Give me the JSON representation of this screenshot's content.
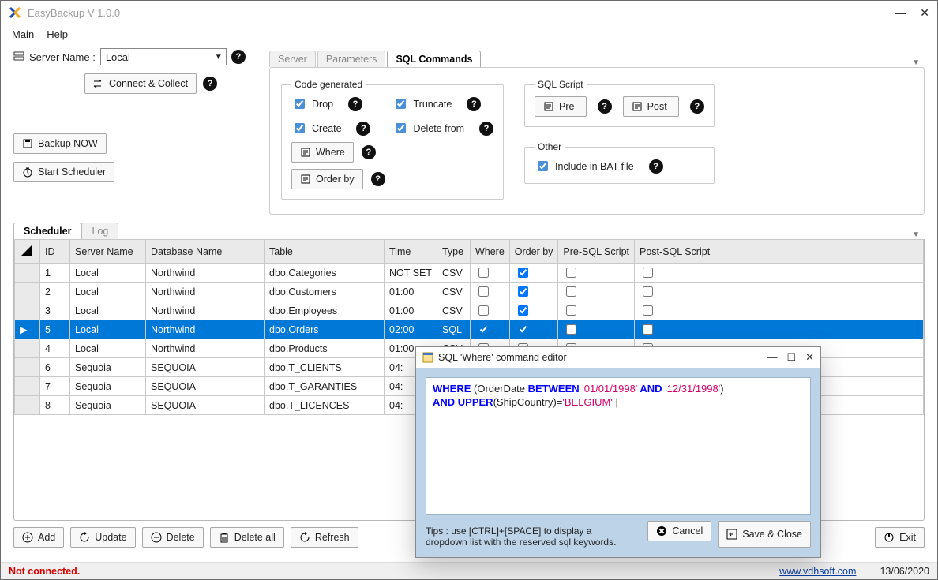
{
  "window": {
    "title": "EasyBackup V 1.0.0"
  },
  "menu": {
    "main": "Main",
    "help": "Help"
  },
  "server": {
    "label": "Server Name :",
    "value": "Local",
    "connect": "Connect & Collect"
  },
  "actions": {
    "backup": "Backup NOW",
    "scheduler": "Start Scheduler"
  },
  "tabs": {
    "server": "Server",
    "parameters": "Parameters",
    "sqlcmds": "SQL Commands"
  },
  "codegen": {
    "legend": "Code generated",
    "drop": "Drop",
    "create": "Create",
    "truncate": "Truncate",
    "deletefrom": "Delete from",
    "where": "Where",
    "orderby": "Order by"
  },
  "sqlscript": {
    "legend": "SQL Script",
    "pre": "Pre-",
    "post": "Post-"
  },
  "other": {
    "legend": "Other",
    "bat": "Include in BAT file"
  },
  "gridtabs": {
    "scheduler": "Scheduler",
    "log": "Log"
  },
  "columns": {
    "id": "ID",
    "server": "Server Name",
    "db": "Database Name",
    "table": "Table",
    "time": "Time",
    "type": "Type",
    "where": "Where",
    "orderby": "Order by",
    "pre": "Pre-SQL Script",
    "post": "Post-SQL Script"
  },
  "rows": [
    {
      "id": "1",
      "server": "Local",
      "db": "Northwind",
      "table": "dbo.Categories",
      "time": "NOT SET",
      "type": "CSV",
      "where": false,
      "orderby": true,
      "pre": false,
      "post": false,
      "selected": false
    },
    {
      "id": "2",
      "server": "Local",
      "db": "Northwind",
      "table": "dbo.Customers",
      "time": "01:00",
      "type": "CSV",
      "where": false,
      "orderby": true,
      "pre": false,
      "post": false,
      "selected": false
    },
    {
      "id": "3",
      "server": "Local",
      "db": "Northwind",
      "table": "dbo.Employees",
      "time": "01:00",
      "type": "CSV",
      "where": false,
      "orderby": true,
      "pre": false,
      "post": false,
      "selected": false
    },
    {
      "id": "5",
      "server": "Local",
      "db": "Northwind",
      "table": "dbo.Orders",
      "time": "02:00",
      "type": "SQL",
      "where": true,
      "orderby": true,
      "pre": false,
      "post": false,
      "selected": true
    },
    {
      "id": "4",
      "server": "Local",
      "db": "Northwind",
      "table": "dbo.Products",
      "time": "01:00",
      "type": "CSV",
      "where": false,
      "orderby": false,
      "pre": false,
      "post": false,
      "selected": false
    },
    {
      "id": "6",
      "server": "Sequoia",
      "db": "SEQUOIA",
      "table": "dbo.T_CLIENTS",
      "time": "04:",
      "type": "",
      "where": false,
      "orderby": false,
      "pre": false,
      "post": false,
      "selected": false
    },
    {
      "id": "7",
      "server": "Sequoia",
      "db": "SEQUOIA",
      "table": "dbo.T_GARANTIES",
      "time": "04:",
      "type": "",
      "where": false,
      "orderby": false,
      "pre": false,
      "post": false,
      "selected": false
    },
    {
      "id": "8",
      "server": "Sequoia",
      "db": "SEQUOIA",
      "table": "dbo.T_LICENCES",
      "time": "04:",
      "type": "",
      "where": false,
      "orderby": false,
      "pre": false,
      "post": false,
      "selected": false
    }
  ],
  "toolbar": {
    "add": "Add",
    "update": "Update",
    "delete": "Delete",
    "deleteall": "Delete all",
    "refresh": "Refresh",
    "exit": "Exit"
  },
  "status": {
    "text": "Not connected.",
    "link": "www.vdhsoft.com",
    "date": "13/06/2020"
  },
  "dialog": {
    "title": "SQL 'Where' command editor",
    "sql_kw1": "WHERE",
    "sql_t1": " (OrderDate ",
    "sql_kw2": "BETWEEN",
    "sql_s1": " '01/01/1998'",
    "sql_kw3": " AND",
    "sql_s2": " '12/31/1998'",
    "sql_t2": ")\n",
    "sql_kw4": "AND UPPER",
    "sql_t3": "(ShipCountry)=",
    "sql_s3": "'BELGIUM'",
    "sql_cursor": " |",
    "tips1": "Tips  :  use [CTRL]+[SPACE] to display a",
    "tips2": "dropdown list with the reserved sql keywords.",
    "cancel": "Cancel",
    "save": "Save & Close"
  }
}
